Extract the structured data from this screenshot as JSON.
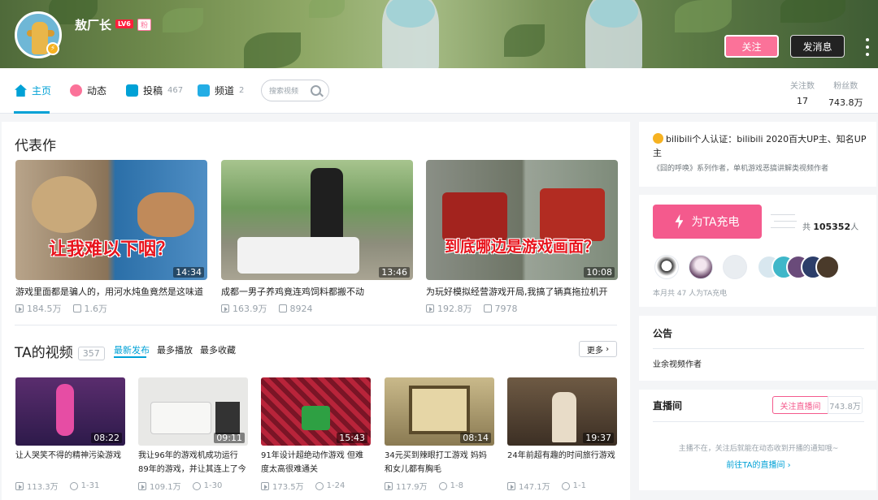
{
  "header": {
    "username": "敖厂长",
    "level": "LV6",
    "fan_badge": "粉",
    "follow_label": "关注",
    "message_label": "发消息"
  },
  "nav": {
    "home": "主页",
    "dynamic": "动态",
    "uploads": "投稿",
    "uploads_count": "467",
    "channels": "频道",
    "channels_count": "2",
    "search_placeholder": "搜索视频",
    "following_label": "关注数",
    "following_value": "17",
    "fans_label": "粉丝数",
    "fans_value": "743.8万"
  },
  "masterpieces": {
    "title": "代表作",
    "items": [
      {
        "caption": "让我难以下咽？",
        "duration": "14:34",
        "title": "游戏里面都是骗人的，用河水炖鱼竟然是这味道",
        "views": "184.5万",
        "danmaku": "1.6万"
      },
      {
        "caption": "",
        "duration": "13:46",
        "title": "成都一男子养鸡竟连鸡饲料都搬不动",
        "views": "163.9万",
        "danmaku": "8924"
      },
      {
        "caption": "到底哪边是游戏画面？",
        "duration": "10:08",
        "title": "为玩好模拟经营游戏开局,我搞了辆真拖拉机开",
        "views": "192.8万",
        "danmaku": "7978"
      }
    ]
  },
  "videos": {
    "title": "TA的视频",
    "count": "357",
    "tabs": [
      "最新发布",
      "最多播放",
      "最多收藏"
    ],
    "more_label": "更多",
    "items": [
      {
        "duration": "08:22",
        "title": "让人哭笑不得的精神污染游戏",
        "views": "113.3万",
        "date": "1-31"
      },
      {
        "duration": "09:11",
        "title": "我让96年的游戏机成功运行89年的游戏，并让其连上了今",
        "views": "109.1万",
        "date": "1-30"
      },
      {
        "duration": "15:43",
        "title": "91年设计超绝动作游戏 但难度太高很难通关",
        "views": "173.5万",
        "date": "1-24"
      },
      {
        "duration": "08:14",
        "title": "34元买到辣眼打工游戏 妈妈和女儿都有胸毛",
        "views": "117.9万",
        "date": "1-8"
      },
      {
        "duration": "19:37",
        "title": "24年前超有趣的时间旅行游戏",
        "views": "147.1万",
        "date": "1-1"
      }
    ]
  },
  "sidebar": {
    "verify_text": "bilibili个人认证：bilibili 2020百大UP主、知名UP主",
    "verify_sub": "《囧的呼唤》系列作者，单机游戏恶搞讲解类视频作者",
    "charge_label": "为TA充电",
    "charge_total_prefix": "共",
    "charge_total_value": "105352",
    "charge_total_suffix": "人",
    "charge_note": "本月共 47 人为TA充电",
    "notice_title": "公告",
    "notice_text": "业余视频作者",
    "live_title": "直播间",
    "live_follow_label": "关注直播间",
    "live_count": "743.8万",
    "live_empty": "主播不在，关注后就能在动态收到开播的通知哦~",
    "live_link": "前往TA的直播间"
  },
  "colors": {
    "accent": "#00a1d6",
    "pink": "#fb7299",
    "charge": "#f45a8d"
  }
}
